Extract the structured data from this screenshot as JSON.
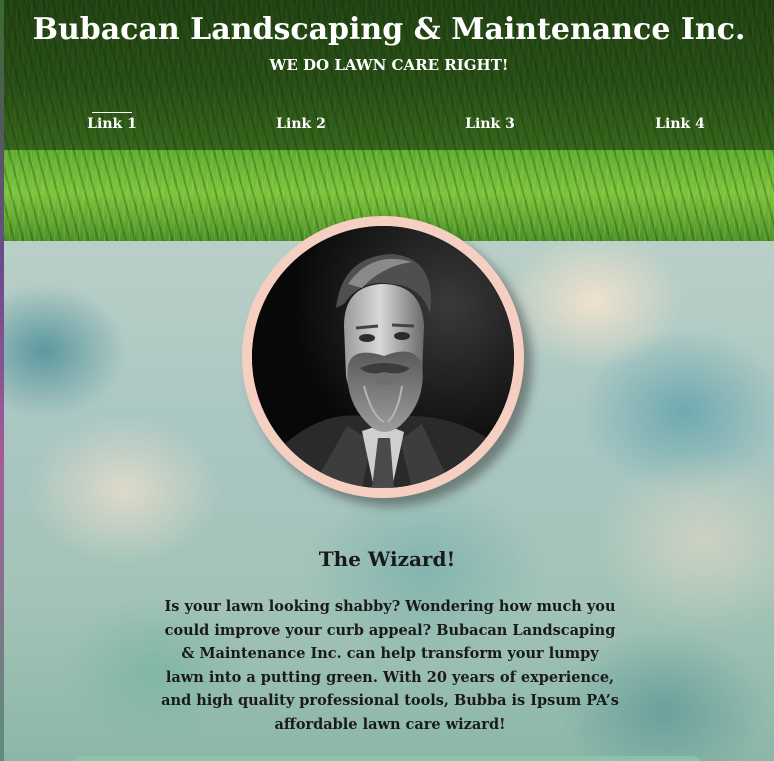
{
  "header": {
    "title": "Bubacan Landscaping & Maintenance Inc.",
    "tagline": "WE DO LAWN CARE RIGHT!"
  },
  "nav": {
    "links": [
      {
        "label": "Link 1",
        "active": true
      },
      {
        "label": "Link 2",
        "active": false
      },
      {
        "label": "Link 3",
        "active": false
      },
      {
        "label": "Link 4",
        "active": false
      }
    ]
  },
  "profile": {
    "heading": "The Wizard!",
    "body": "Is your lawn looking shabby? Wondering how much you could improve your curb appeal? Bubacan Landscaping & Maintenance Inc. can help transform your lumpy lawn into a putting green. With 20 years of experience, and high quality professional tools, Bubba is Ipsum PA’s affordable lawn care wizard!"
  },
  "colors": {
    "header_text": "#ffffff",
    "portrait_ring": "#f4cfc2",
    "body_text": "#1a1a1a"
  }
}
